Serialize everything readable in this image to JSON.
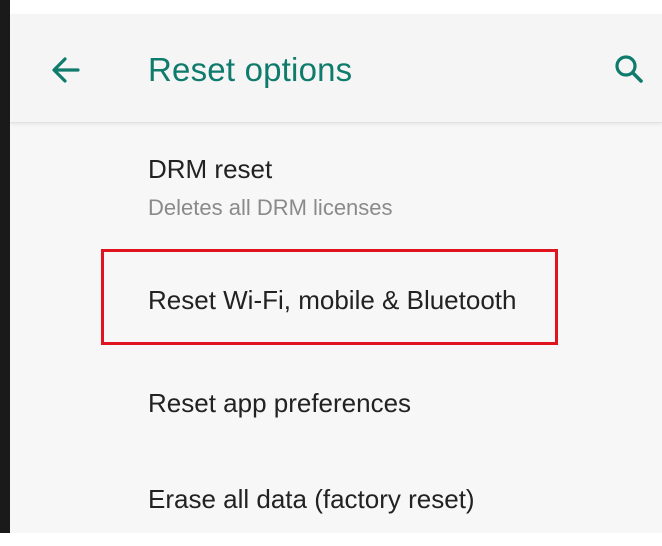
{
  "appbar": {
    "back_icon": "arrow-left-icon",
    "title": "Reset options",
    "search_icon": "search-icon",
    "accent_color": "#0f7b6c"
  },
  "items": [
    {
      "title": "DRM reset",
      "subtitle": "Deletes all DRM licenses"
    },
    {
      "title": "Reset Wi-Fi, mobile & Bluetooth"
    },
    {
      "title": "Reset app preferences"
    },
    {
      "title": "Erase all data (factory reset)"
    }
  ],
  "annotation": {
    "highlight_color": "#e0141e",
    "highlighted_item": "Reset Wi-Fi, mobile & Bluetooth"
  }
}
